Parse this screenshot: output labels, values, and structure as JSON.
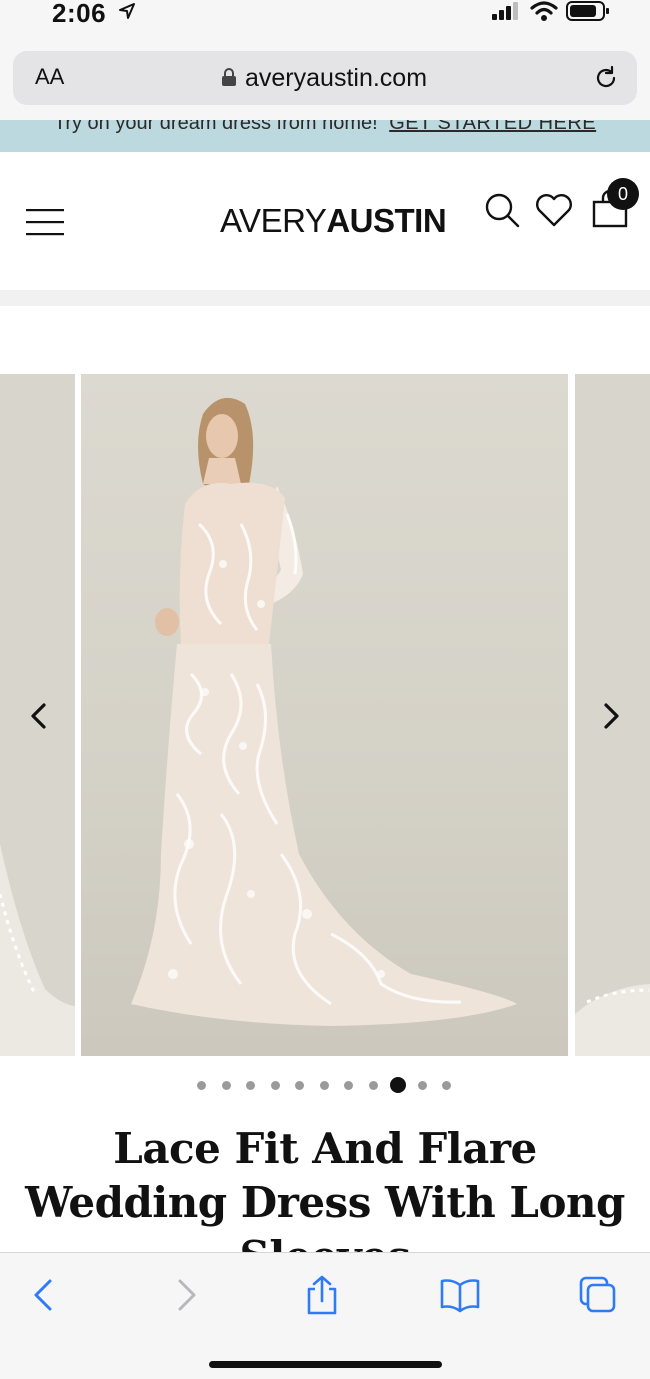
{
  "status_bar": {
    "time": "2:06"
  },
  "browser": {
    "aa_label": "AA",
    "url": "averyaustin.com"
  },
  "promo": {
    "text": "Try on your dream dress from home!",
    "link": "GET STARTED HERE"
  },
  "header": {
    "logo_light": "AVERY",
    "logo_bold": "AUSTIN",
    "cart_count": "0"
  },
  "carousel": {
    "dot_count": 11,
    "active_index": 8
  },
  "product": {
    "title": "Lace Fit And Flare Wedding Dress With Long Sleeves"
  },
  "colors": {
    "promo_bg": "#bcd9df",
    "photo_bg": "#d8d5cc",
    "toolbar_blue": "#2f7bf6"
  }
}
